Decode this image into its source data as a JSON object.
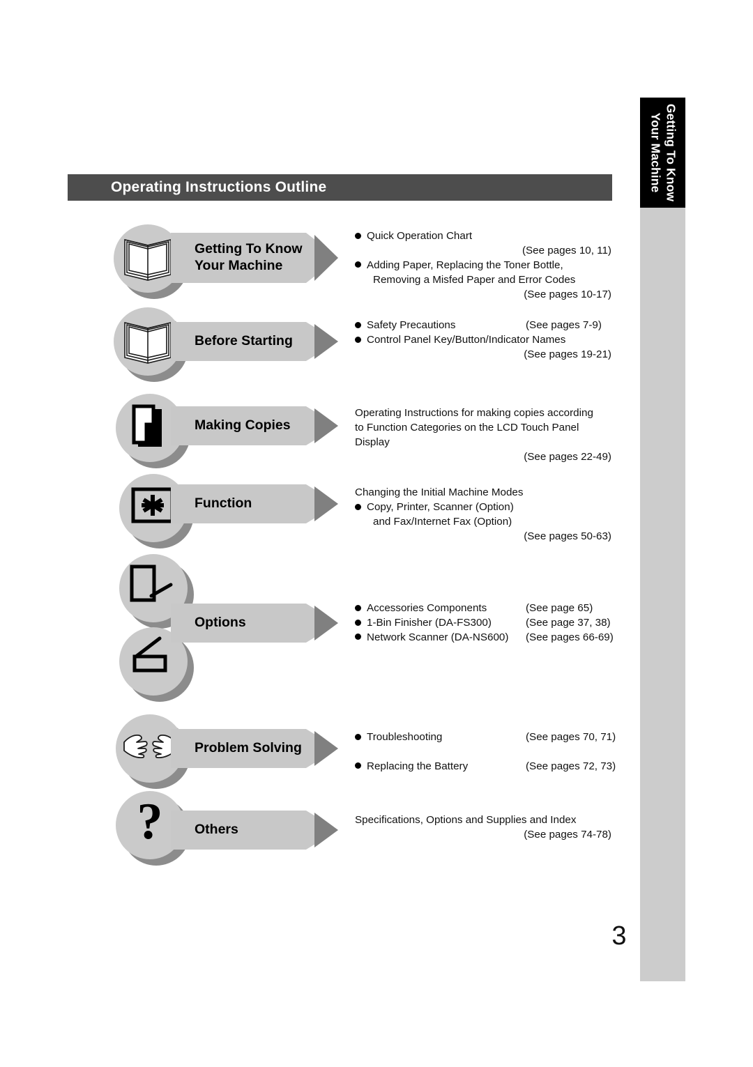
{
  "header": {
    "title": "Operating Instructions Outline"
  },
  "side_tab": {
    "line1": "Getting To Know",
    "line2": "Your Machine"
  },
  "page_number": "3",
  "sections": [
    {
      "id": "getting-to-know",
      "icon": "open-book-icon",
      "label": "Getting To Know\nYour Machine",
      "lines": [
        {
          "kind": "bullet",
          "text": "Quick Operation Chart"
        },
        {
          "kind": "pages",
          "text": "(See pages 10, 11)"
        },
        {
          "kind": "bullet",
          "text": "Adding Paper, Replacing the Toner Bottle,"
        },
        {
          "kind": "cont",
          "text": "Removing a Misfed Paper and Error Codes"
        },
        {
          "kind": "pages",
          "text": "(See pages 10-17)"
        }
      ]
    },
    {
      "id": "before-starting",
      "icon": "open-book-icon",
      "label": "Before Starting",
      "lines": [
        {
          "kind": "bullet-pages",
          "text": "Safety Precautions",
          "pages": "(See pages 7-9)"
        },
        {
          "kind": "bullet",
          "text": "Control Panel Key/Button/Indicator Names"
        },
        {
          "kind": "pages",
          "text": "(See pages 19-21)"
        }
      ]
    },
    {
      "id": "making-copies",
      "icon": "copy-pages-icon",
      "label": "Making Copies",
      "lines": [
        {
          "kind": "plain",
          "text": "Operating Instructions for making copies according"
        },
        {
          "kind": "plain",
          "text": "to Function Categories on the LCD Touch Panel"
        },
        {
          "kind": "plain",
          "text": "Display"
        },
        {
          "kind": "pages",
          "text": "(See pages 22-49)"
        }
      ]
    },
    {
      "id": "function",
      "icon": "asterisk-key-icon",
      "label": "Function",
      "lines": [
        {
          "kind": "plain",
          "text": "Changing the Initial Machine Modes"
        },
        {
          "kind": "bullet",
          "text": "Copy, Printer, Scanner (Option)"
        },
        {
          "kind": "cont",
          "text": "and Fax/Internet Fax (Option)"
        },
        {
          "kind": "pages",
          "text": "(See pages 50-63)"
        }
      ]
    },
    {
      "id": "options",
      "icon": "finisher-icon",
      "icon2": "scanner-icon",
      "label": "Options",
      "lines": [
        {
          "kind": "bullet-pages",
          "text": "Accessories Components",
          "pages": "(See page 65)"
        },
        {
          "kind": "bullet-pages",
          "text": "1-Bin Finisher (DA-FS300)",
          "pages": "(See page 37, 38)"
        },
        {
          "kind": "bullet-pages",
          "text": "Network Scanner (DA-NS600)",
          "pages": "(See pages 66-69)"
        }
      ]
    },
    {
      "id": "problem-solving",
      "icon": "helping-hands-icon",
      "label": "Problem Solving",
      "lines": [
        {
          "kind": "bullet-pages",
          "text": "Troubleshooting",
          "pages": "(See pages 70, 71)"
        },
        {
          "kind": "spacer",
          "text": ""
        },
        {
          "kind": "bullet-pages",
          "text": "Replacing the Battery",
          "pages": "(See pages 72, 73)"
        }
      ]
    },
    {
      "id": "others",
      "icon": "question-mark-icon",
      "label": "Others",
      "lines": [
        {
          "kind": "plain",
          "text": "Specifications, Options and Supplies and Index"
        },
        {
          "kind": "pages",
          "text": "(See pages 74-78)"
        }
      ]
    }
  ]
}
